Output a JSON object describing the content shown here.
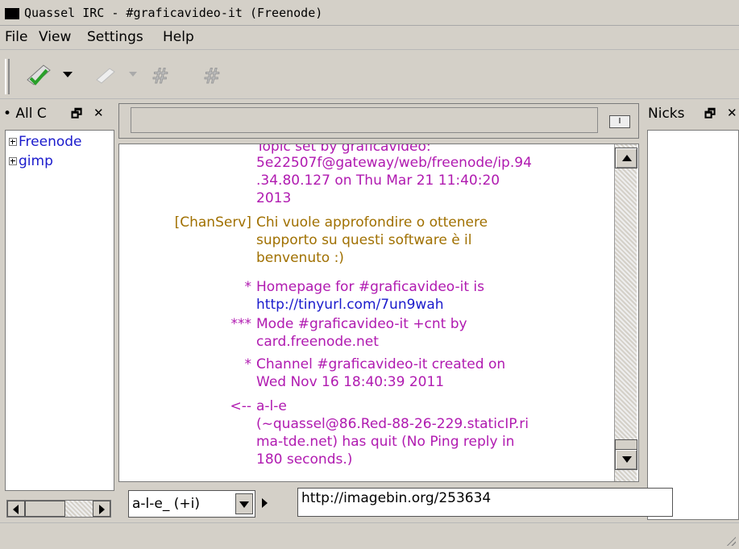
{
  "window": {
    "title": "Quassel IRC - #graficavideo-it (Freenode)"
  },
  "menu": [
    "File",
    "View",
    "Settings",
    "Help"
  ],
  "toolbar": {
    "icons": [
      "connect-icon",
      "disconnect-icon",
      "join-channel-icon",
      "part-channel-icon"
    ]
  },
  "chat_list": {
    "title": "• All C",
    "items": [
      {
        "label": "Freenode"
      },
      {
        "label": "gimp"
      }
    ]
  },
  "nicks": {
    "title": "Nicks"
  },
  "chat": {
    "topic_line": "Topic set by graficavideo:",
    "messages": [
      {
        "sender": "",
        "lines": [
          "5e22507f@gateway/web/freenode/ip.94",
          ".34.80.127 on Thu Mar 21 11:40:20",
          "2013"
        ],
        "kind": "topic"
      },
      {
        "sender": "[ChanServ]",
        "lines": [
          "Chi vuole approfondire o ottenere",
          "supporto su questi software è il",
          "benvenuto :)"
        ],
        "kind": "chanserv"
      },
      {
        "sender": "*",
        "lines": [
          "Homepage for #graficavideo-it is"
        ],
        "link": "http://tinyurl.com/7un9wah",
        "kind": "topic"
      },
      {
        "sender": "***",
        "lines": [
          "Mode #graficavideo-it +cnt by",
          "card.freenode.net"
        ],
        "kind": "topic"
      },
      {
        "sender": "*",
        "lines": [
          "Channel #graficavideo-it created on",
          "Wed Nov 16 18:40:39 2011"
        ],
        "kind": "topic"
      },
      {
        "sender": "<--",
        "lines": [
          "a-l-e",
          "(~quassel@86.Red-88-26-229.staticIP.ri",
          "ma-tde.net) has quit (No Ping reply in",
          "180 seconds.)"
        ],
        "kind": "topic"
      }
    ]
  },
  "input": {
    "nick": "a-l-e_ (+i)",
    "text": "http://imagebin.org/253634"
  },
  "colors": {
    "topic": "#b01ab0",
    "chanserv": "#a07000",
    "link": "#1a1acc"
  }
}
